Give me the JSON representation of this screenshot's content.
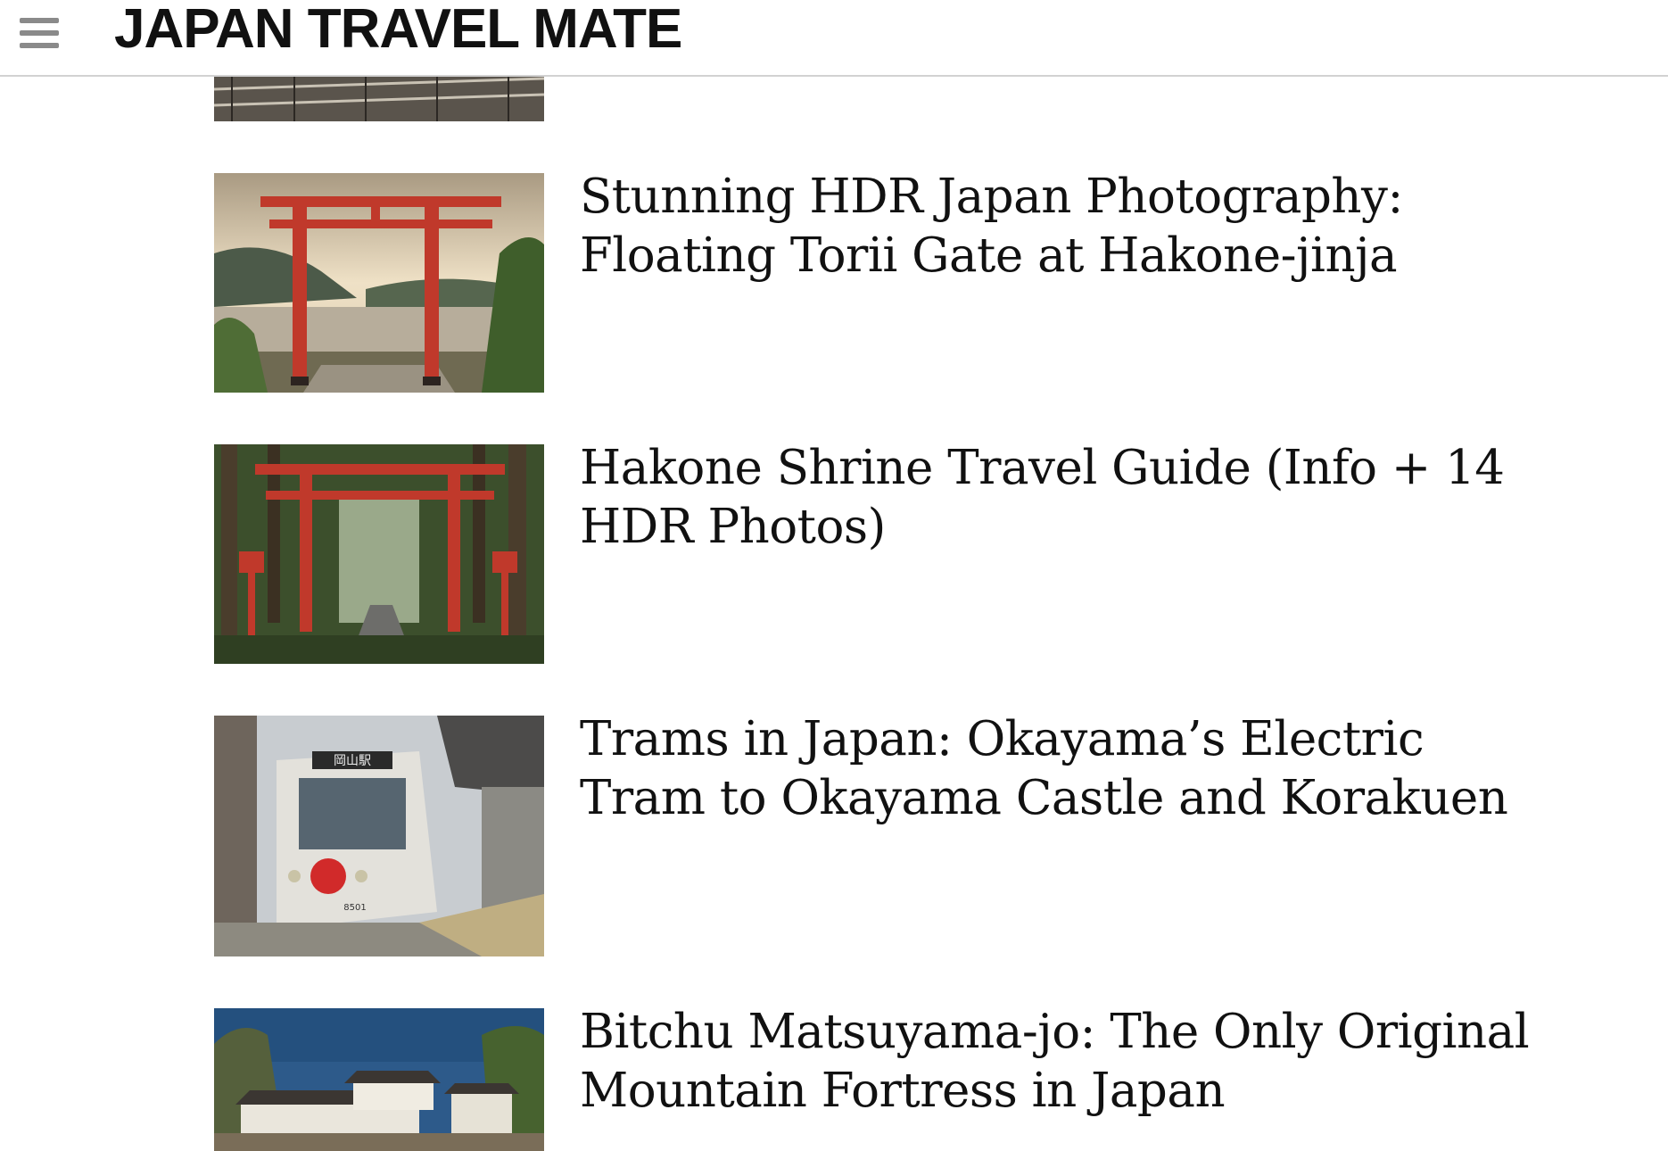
{
  "header": {
    "menu_icon": "hamburger-menu-icon",
    "site_title": "JAPAN TRAVEL MATE"
  },
  "posts": [
    {
      "title": "",
      "thumbnail_icon": "train-station-photo"
    },
    {
      "title": "Stunning HDR Japan Photography: Floating Torii Gate at Hakone-jinja",
      "thumbnail_icon": "torii-lake-photo"
    },
    {
      "title": "Hakone Shrine Travel Guide (Info + 14 HDR Photos)",
      "thumbnail_icon": "torii-forest-photo"
    },
    {
      "title": "Trams in Japan: Okayama’s Electric Tram to Okayama Castle and Korakuen",
      "thumbnail_icon": "tram-photo",
      "tram_sign": "岡山駅",
      "tram_number": "8501"
    },
    {
      "title": "Bitchu Matsuyama-jo: The Only Original Mountain Fortress in Japan",
      "thumbnail_icon": "castle-photo"
    }
  ],
  "colors": {
    "torii_red": "#c0392b",
    "header_border": "#d2d2d2",
    "menu_icon": "#8a8a8a"
  }
}
